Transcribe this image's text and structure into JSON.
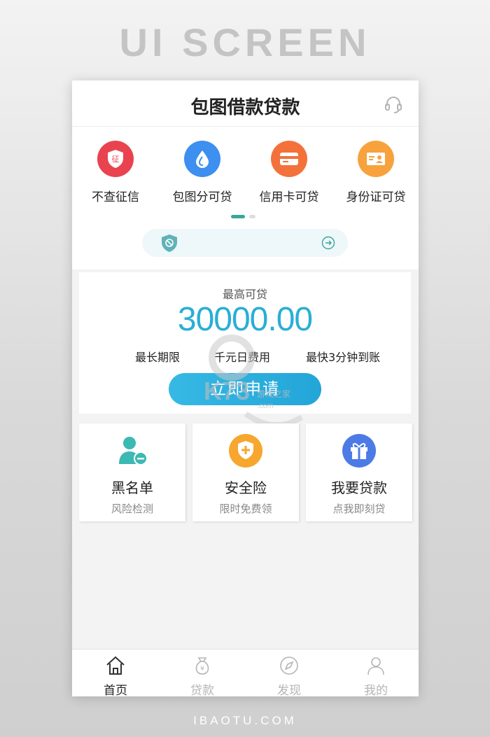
{
  "showcase": {
    "title": "UI SCREEN",
    "footer": "IBAOTU.COM"
  },
  "header": {
    "title": "包图借款贷款",
    "support_icon": "headset-icon"
  },
  "categories": [
    {
      "label": "不查征信",
      "icon": "credit-seal-icon",
      "icon_text": "征",
      "color": "#e9434f"
    },
    {
      "label": "包图分可贷",
      "icon": "droplet-icon",
      "color": "#3d8ff0"
    },
    {
      "label": "信用卡可贷",
      "icon": "credit-card-icon",
      "color": "#f4713b"
    },
    {
      "label": "身份证可贷",
      "icon": "id-card-icon",
      "color": "#f7a23d"
    }
  ],
  "carousel": {
    "active_index": 0,
    "count": 2
  },
  "notice": {
    "text": ""
  },
  "loan": {
    "label": "最高可贷",
    "amount": "30000.00",
    "terms": [
      "最长期限",
      "千元日费用",
      "最快3分钟到账"
    ],
    "apply_label": "立即申请"
  },
  "watermark": {
    "text": "K73",
    "sub": "游戏之家",
    "domain": ".com"
  },
  "features": [
    {
      "title": "黑名单",
      "subtitle": "风险检测",
      "icon": "blacklist-user-icon",
      "color": "#3cb9b3"
    },
    {
      "title": "安全险",
      "subtitle": "限时免费领",
      "icon": "shield-plus-icon",
      "color": "#f7a62e"
    },
    {
      "title": "我要贷款",
      "subtitle": "点我即刻贷",
      "icon": "gift-icon",
      "color": "#4d7be6"
    }
  ],
  "tabs": [
    {
      "label": "首页",
      "icon": "home-icon",
      "active": true
    },
    {
      "label": "贷款",
      "icon": "money-bag-icon",
      "active": false
    },
    {
      "label": "发现",
      "icon": "compass-icon",
      "active": false
    },
    {
      "label": "我的",
      "icon": "person-icon",
      "active": false
    }
  ],
  "colors": {
    "accent": "#2aaed6",
    "indicator": "#3aa69a"
  }
}
